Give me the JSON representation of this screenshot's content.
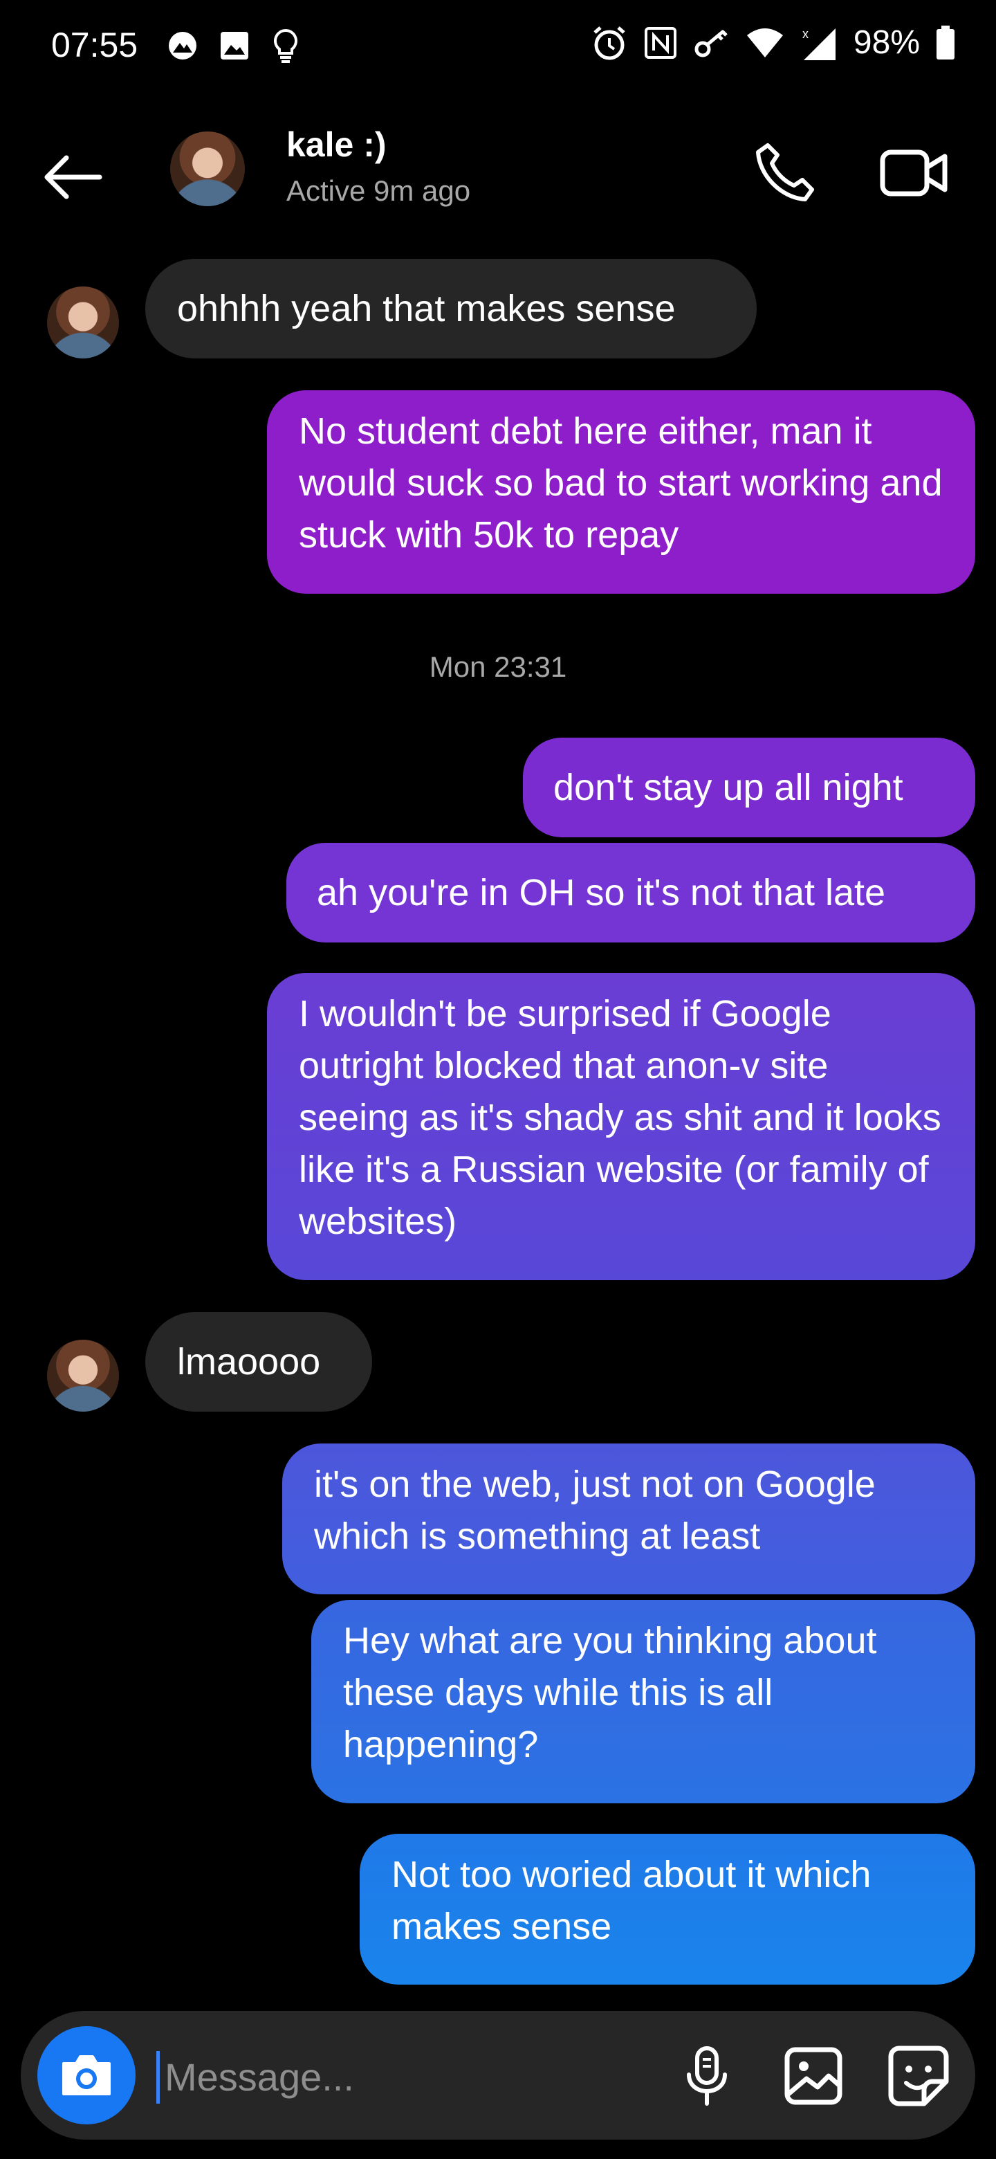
{
  "status_bar": {
    "time": "07:55",
    "battery": "98%",
    "left_icons": [
      "vpn-icon",
      "image-icon",
      "lightbulb-icon"
    ],
    "right_icons": [
      "alarm-icon",
      "nfc-icon",
      "key-icon",
      "wifi-icon",
      "signal-icon",
      "battery-icon"
    ]
  },
  "header": {
    "contact_name": "kale :)",
    "status": "Active 9m ago"
  },
  "messages": [
    {
      "side": "received",
      "text": "ohhhh yeah that makes sense"
    },
    {
      "side": "sent",
      "text": "No student debt here either, man it would suck so bad to start working and stuck with 50k to repay"
    },
    {
      "side": "sent",
      "text": "don't stay up all night"
    },
    {
      "side": "sent",
      "text": "ah you're in OH so it's not that late"
    },
    {
      "side": "sent",
      "text": "I wouldn't be surprised if Google outright blocked that anon-v site seeing as it's shady as shit and it looks like it's a Russian website (or family of websites)"
    },
    {
      "side": "received",
      "text": "lmaoooo"
    },
    {
      "side": "sent",
      "text": "it's on the web, just not on Google which is something at least"
    },
    {
      "side": "sent",
      "text": "Hey what are you thinking about these days while this is all happening?"
    },
    {
      "side": "sent",
      "text": "Not too woried about it which makes sense"
    }
  ],
  "timestamp": "Mon 23:31",
  "composer": {
    "placeholder": "Message..."
  },
  "colors": {
    "received_bubble": "#262626",
    "sent_gradient_top": "#8e1bc9",
    "sent_gradient_bottom": "#1a86ec",
    "camera_button": "#1877f2"
  }
}
